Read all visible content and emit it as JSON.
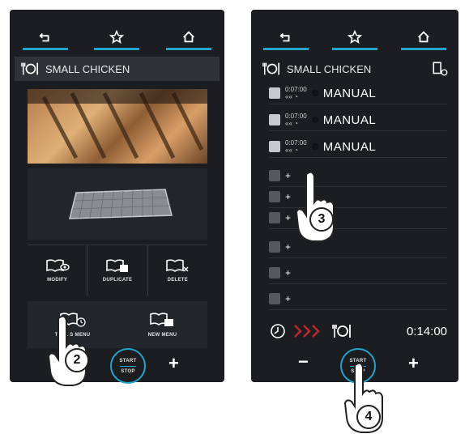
{
  "left_panel": {
    "nav": [
      {
        "icon": "back-icon"
      },
      {
        "icon": "star-icon"
      },
      {
        "icon": "home-icon"
      }
    ],
    "title": "SMALL CHICKEN",
    "actions": [
      {
        "label": "MODIFY",
        "icon": "book-eye-icon"
      },
      {
        "label": "DUPLICATE",
        "icon": "book-copy-icon"
      },
      {
        "label": "DELETE",
        "icon": "book-delete-icon"
      }
    ],
    "menus": [
      {
        "label": "TO ... S MENU",
        "icon": "book-clock-icon"
      },
      {
        "label": "NEW MENU",
        "icon": "book-new-icon"
      }
    ],
    "start": "START",
    "stop": "STOP",
    "plus": "+",
    "callout": "2"
  },
  "right_panel": {
    "nav": [
      {
        "icon": "back-icon"
      },
      {
        "icon": "star-icon"
      },
      {
        "icon": "home-icon"
      }
    ],
    "title": "SMALL CHICKEN",
    "steps": [
      {
        "time": "0:07:00",
        "mode": "MANUAL"
      },
      {
        "time": "0:07:00",
        "mode": "MANUAL"
      },
      {
        "time": "0:07:00",
        "mode": "MANUAL"
      }
    ],
    "empty_steps": [
      "+",
      "+",
      "+",
      "+",
      "+",
      "+"
    ],
    "total_time": "0:14:00",
    "minus": "−",
    "plus": "+",
    "start": "START",
    "stop": "STOP",
    "callouts": [
      "3",
      "4"
    ]
  },
  "colors": {
    "accent": "#21a5cc",
    "panel": "#1b1d20"
  }
}
